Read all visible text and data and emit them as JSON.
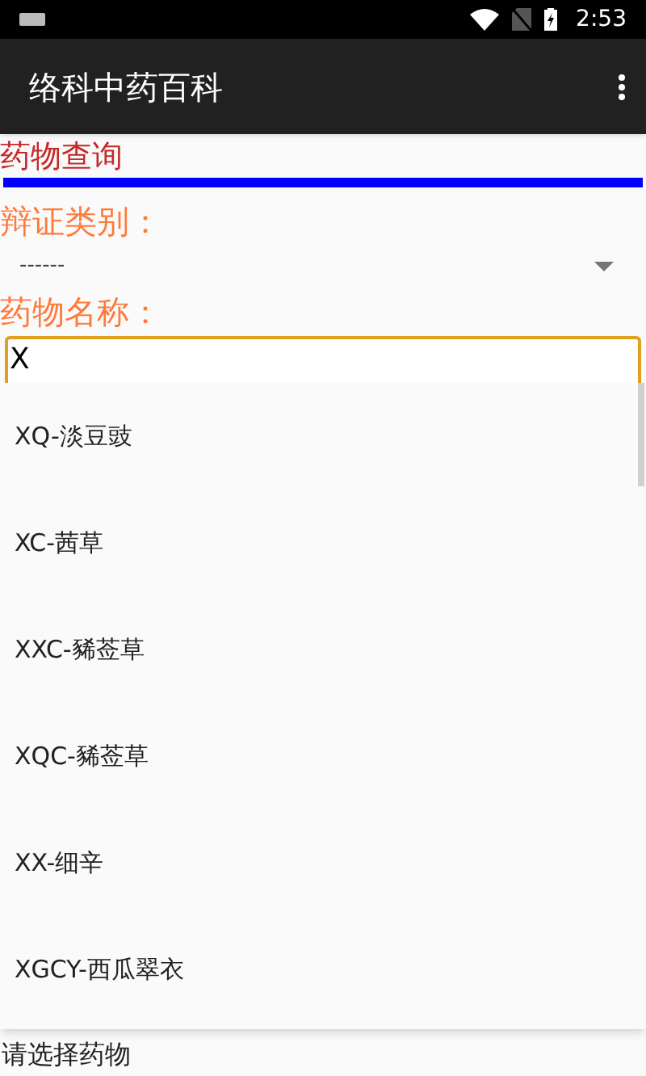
{
  "status_bar": {
    "time": "2:53"
  },
  "app_bar": {
    "title": "络科中药百科"
  },
  "section_title": "药物查询",
  "category": {
    "label": "辩证类别：",
    "value": "------"
  },
  "drug_name": {
    "label": "药物名称：",
    "value": "X"
  },
  "suggestions": [
    {
      "label": "XQ-淡豆豉"
    },
    {
      "label": "XC-茜草"
    },
    {
      "label": "XXC-豨莶草"
    },
    {
      "label": "XQC-豨莶草"
    },
    {
      "label": "XX-细辛"
    },
    {
      "label": "XGCY-西瓜翠衣"
    }
  ],
  "hint": "请选择药物"
}
